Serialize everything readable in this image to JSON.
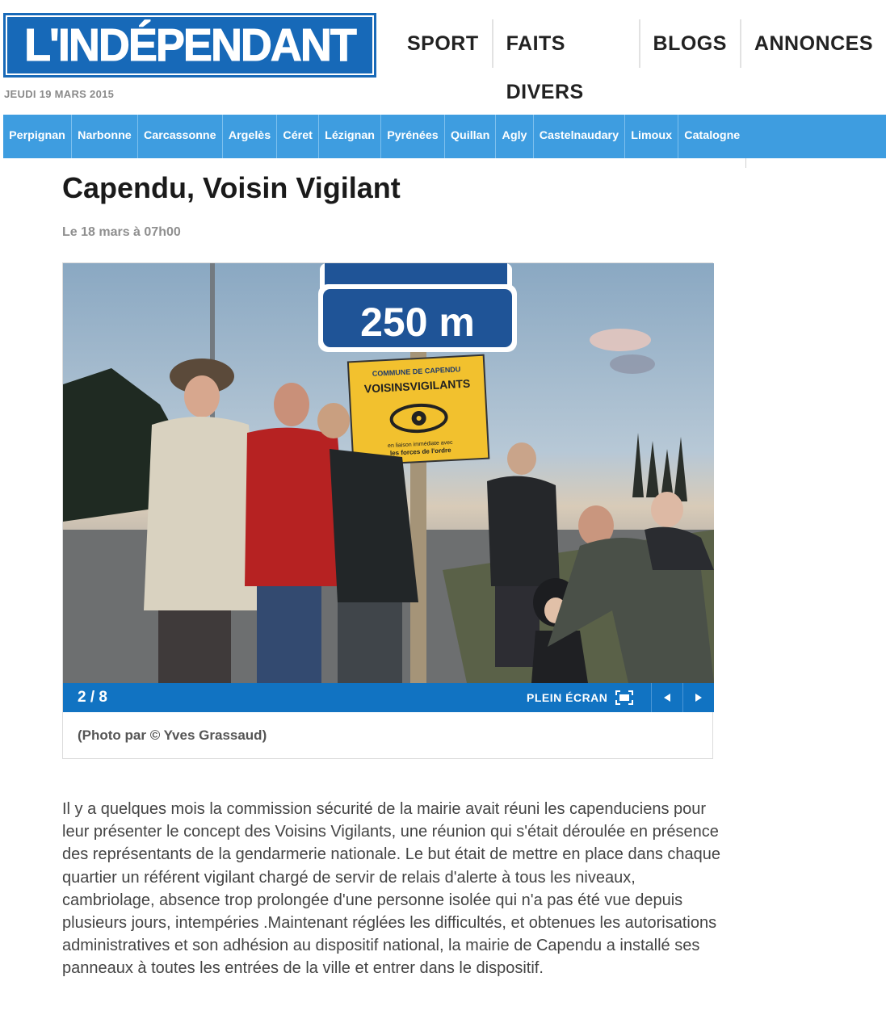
{
  "header": {
    "logo_text": "L'INDÉPENDANT",
    "topnav": [
      "SPORT",
      "FAITS DIVERS",
      "BLOGS",
      "ANNONCES"
    ],
    "date": "JEUDI 19 MARS 2015"
  },
  "citynav": [
    "Perpignan",
    "Narbonne",
    "Carcassonne",
    "Argelès",
    "Céret",
    "Lézignan",
    "Pyrénées",
    "Quillan",
    "Agly",
    "Castelnaudary",
    "Limoux",
    "Catalogne"
  ],
  "article": {
    "title": "Capendu, Voisin Vigilant",
    "date": "Le 18 mars à 07h00",
    "gallery": {
      "counter": "2 / 8",
      "fullscreen_label": "PLEIN ÉCRAN",
      "prev_icon": "triangle-left-icon",
      "next_icon": "triangle-right-icon",
      "caption": "(Photo par © Yves Grassaud)",
      "photo": {
        "sign_distance": "250 m",
        "sign_top_line": "COMMUNE DE CAPENDU",
        "sign_main": "VOISINSVIGILANTS",
        "sign_bottom_1": "en liaison immédiate avec",
        "sign_bottom_2": "les forces de l'ordre"
      }
    },
    "body": "Il y a quelques mois la commission sécurité de la mairie avait réuni les capenduciens pour leur présenter le concept des Voisins Vigilants, une réunion qui s'était déroulée en présence des représentants de la gendarmerie nationale. Le but était de mettre en place dans chaque quartier un référent vigilant chargé de servir de relais d'alerte à tous les niveaux, cambriolage, absence trop prolongée d'une personne isolée qui n'a pas été vue depuis plusieurs jours, intempéries .Maintenant réglées les difficultés, et obtenues les autorisations administratives et son adhésion au dispositif national, la mairie de Capendu a installé ses panneaux à toutes les entrées de la ville et entrer dans le dispositif."
  },
  "colors": {
    "brand_blue": "#1769b8",
    "citybar_blue": "#3e9de0",
    "gallery_bar_blue": "#1173c2",
    "sign_yellow": "#f2c12e"
  }
}
